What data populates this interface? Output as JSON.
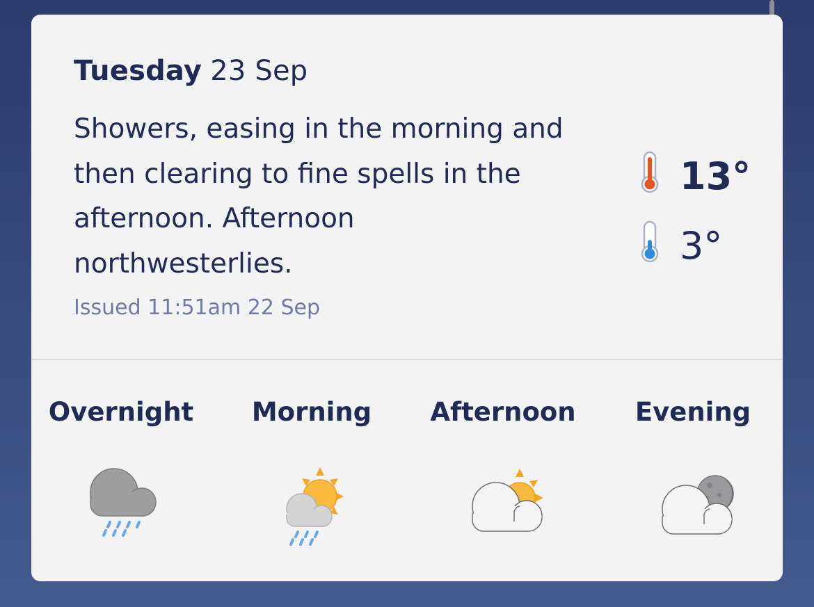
{
  "forecast": {
    "day": "Tuesday",
    "date": "23 Sep",
    "summary": "Showers, easing in the morning and then clearing to fine spells in the afternoon. Afternoon northwesterlies.",
    "issued": "Issued 11:51am 22 Sep",
    "max_temp": "13°",
    "min_temp": "3°",
    "max_icon": "thermometer-hot-icon",
    "min_icon": "thermometer-cold-icon"
  },
  "periods": [
    {
      "label": "Overnight",
      "icon": "cloud-rain-icon"
    },
    {
      "label": "Morning",
      "icon": "sun-cloud-rain-icon"
    },
    {
      "label": "Afternoon",
      "icon": "sun-cloud-icon"
    },
    {
      "label": "Evening",
      "icon": "moon-cloud-icon"
    }
  ],
  "colors": {
    "text": "#1f2a55",
    "muted": "#6f7ba3",
    "card": "#f4f3f4",
    "max_temp": "#e8541a",
    "min_temp": "#2f8bdc",
    "sun": "#f8b93d",
    "rain": "#64a7ee"
  }
}
